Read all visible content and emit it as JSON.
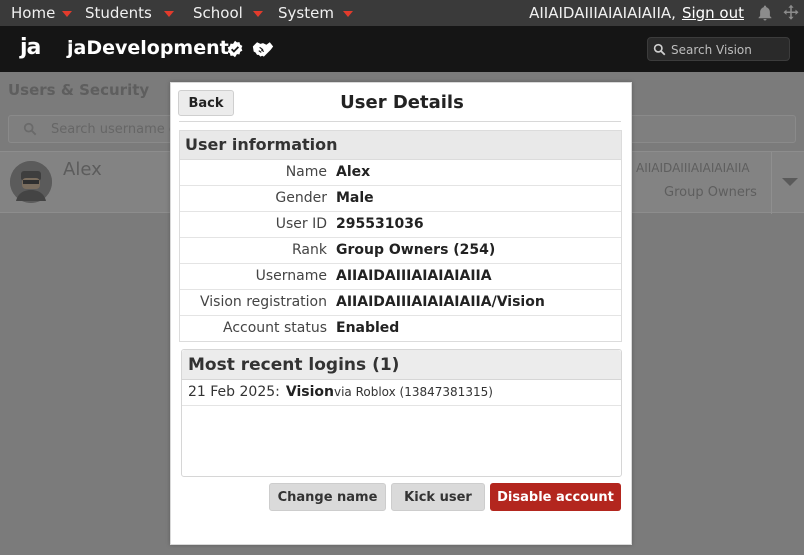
{
  "topbar": {
    "menu": [
      {
        "label": "Home"
      },
      {
        "label": "Students"
      },
      {
        "label": "School"
      },
      {
        "label": "System"
      }
    ],
    "username": "AIIAIDAIIIAIAIAIAIIA,",
    "signout_label": "Sign out",
    "caret_color": "#e23b2c"
  },
  "brand": {
    "logo_text": "ja",
    "name": "jaDevelopment",
    "icons": [
      "verified-icon",
      "handshake-icon"
    ]
  },
  "search": {
    "placeholder": "Search Vision"
  },
  "background_page": {
    "title": "Users & Security",
    "search_placeholder": "Search username o",
    "user_card": {
      "name": "Alex",
      "username": "AIIAIDAIIIAIAIAIAIIA",
      "role": "Group Owners"
    }
  },
  "modal": {
    "back_label": "Back",
    "title": "User Details",
    "info": {
      "heading": "User information",
      "rows": [
        {
          "label": "Name",
          "value": "Alex"
        },
        {
          "label": "Gender",
          "value": "Male"
        },
        {
          "label": "User ID",
          "value": "295531036"
        },
        {
          "label": "Rank",
          "value": "Group Owners (254)"
        },
        {
          "label": "Username",
          "value": "AIIAIDAIIIAIAIAIAIIA"
        },
        {
          "label": "Vision registration",
          "value": "AIIAIDAIIIAIAIAIAIIA/Vision"
        },
        {
          "label": "Account status",
          "value": "Enabled"
        }
      ]
    },
    "logins": {
      "heading": "Most recent logins (1)",
      "items": [
        {
          "date": "21 Feb 2025:",
          "game": "Vision",
          "via": "via Roblox (13847381315)"
        }
      ]
    },
    "buttons": {
      "change_name": "Change name",
      "kick_user": "Kick user",
      "disable_account": "Disable account"
    },
    "danger_color": "#b3261e"
  }
}
